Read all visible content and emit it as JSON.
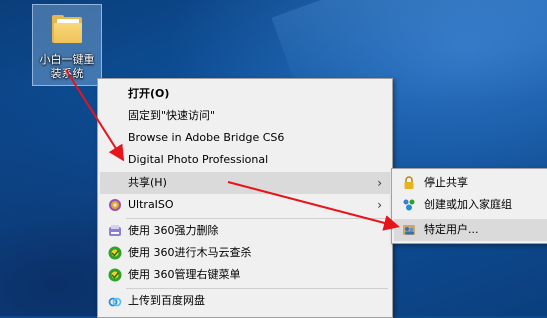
{
  "desktop": {
    "icon": {
      "label": "小白一键重装系统",
      "icon": "folder-icon"
    }
  },
  "context_menu": {
    "items": [
      {
        "label": "打开(O)",
        "bold": true
      },
      {
        "label": "固定到\"快速访问\""
      },
      {
        "label": "Browse in Adobe Bridge CS6"
      },
      {
        "label": "Digital Photo Professional"
      },
      {
        "label": "共享(H)",
        "submenu": true,
        "highlighted": true
      },
      {
        "label": "UltraISO",
        "icon": "ultraiso-disc-icon",
        "submenu": true
      },
      {
        "label": "使用 360强力删除",
        "icon": "360-shredder-icon"
      },
      {
        "label": "使用 360进行木马云查杀",
        "icon": "360-shield-icon"
      },
      {
        "label": "使用 360管理右键菜单",
        "icon": "360-shield-icon"
      },
      {
        "label": "上传到百度网盘",
        "icon": "baidu-netdisk-icon"
      }
    ],
    "submenu_arrow": "›"
  },
  "share_submenu": {
    "items": [
      {
        "label": "停止共享",
        "icon": "lock-icon"
      },
      {
        "label": "创建或加入家庭组",
        "icon": "homegroup-icon"
      },
      {
        "label": "特定用户...",
        "icon": "users-icon",
        "highlighted": true
      }
    ]
  },
  "colors": {
    "annotation_arrow": "#e8141b",
    "menu_background": "#f0f0f0",
    "menu_highlight": "#dadada"
  }
}
